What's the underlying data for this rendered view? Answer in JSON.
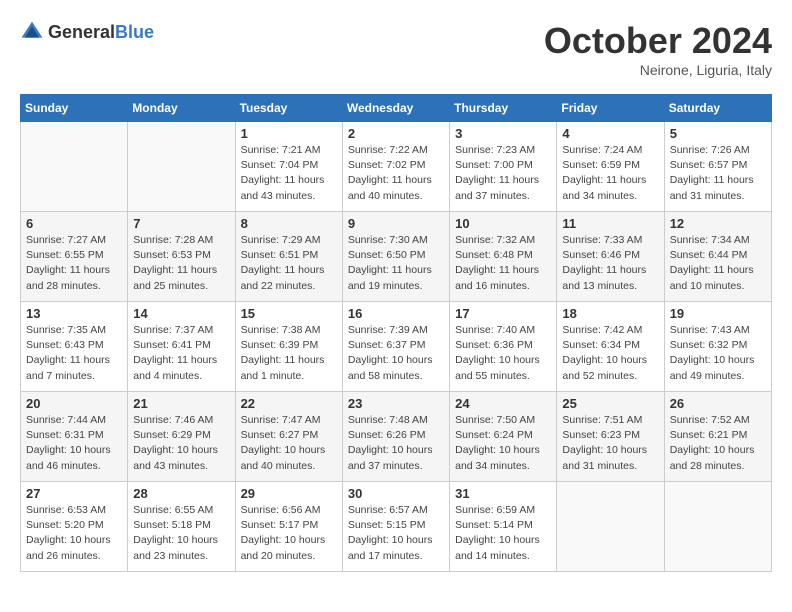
{
  "header": {
    "logo_general": "General",
    "logo_blue": "Blue",
    "month_title": "October 2024",
    "location": "Neirone, Liguria, Italy"
  },
  "days_of_week": [
    "Sunday",
    "Monday",
    "Tuesday",
    "Wednesday",
    "Thursday",
    "Friday",
    "Saturday"
  ],
  "weeks": [
    [
      {
        "day": "",
        "info": ""
      },
      {
        "day": "",
        "info": ""
      },
      {
        "day": "1",
        "info": "Sunrise: 7:21 AM\nSunset: 7:04 PM\nDaylight: 11 hours and 43 minutes."
      },
      {
        "day": "2",
        "info": "Sunrise: 7:22 AM\nSunset: 7:02 PM\nDaylight: 11 hours and 40 minutes."
      },
      {
        "day": "3",
        "info": "Sunrise: 7:23 AM\nSunset: 7:00 PM\nDaylight: 11 hours and 37 minutes."
      },
      {
        "day": "4",
        "info": "Sunrise: 7:24 AM\nSunset: 6:59 PM\nDaylight: 11 hours and 34 minutes."
      },
      {
        "day": "5",
        "info": "Sunrise: 7:26 AM\nSunset: 6:57 PM\nDaylight: 11 hours and 31 minutes."
      }
    ],
    [
      {
        "day": "6",
        "info": "Sunrise: 7:27 AM\nSunset: 6:55 PM\nDaylight: 11 hours and 28 minutes."
      },
      {
        "day": "7",
        "info": "Sunrise: 7:28 AM\nSunset: 6:53 PM\nDaylight: 11 hours and 25 minutes."
      },
      {
        "day": "8",
        "info": "Sunrise: 7:29 AM\nSunset: 6:51 PM\nDaylight: 11 hours and 22 minutes."
      },
      {
        "day": "9",
        "info": "Sunrise: 7:30 AM\nSunset: 6:50 PM\nDaylight: 11 hours and 19 minutes."
      },
      {
        "day": "10",
        "info": "Sunrise: 7:32 AM\nSunset: 6:48 PM\nDaylight: 11 hours and 16 minutes."
      },
      {
        "day": "11",
        "info": "Sunrise: 7:33 AM\nSunset: 6:46 PM\nDaylight: 11 hours and 13 minutes."
      },
      {
        "day": "12",
        "info": "Sunrise: 7:34 AM\nSunset: 6:44 PM\nDaylight: 11 hours and 10 minutes."
      }
    ],
    [
      {
        "day": "13",
        "info": "Sunrise: 7:35 AM\nSunset: 6:43 PM\nDaylight: 11 hours and 7 minutes."
      },
      {
        "day": "14",
        "info": "Sunrise: 7:37 AM\nSunset: 6:41 PM\nDaylight: 11 hours and 4 minutes."
      },
      {
        "day": "15",
        "info": "Sunrise: 7:38 AM\nSunset: 6:39 PM\nDaylight: 11 hours and 1 minute."
      },
      {
        "day": "16",
        "info": "Sunrise: 7:39 AM\nSunset: 6:37 PM\nDaylight: 10 hours and 58 minutes."
      },
      {
        "day": "17",
        "info": "Sunrise: 7:40 AM\nSunset: 6:36 PM\nDaylight: 10 hours and 55 minutes."
      },
      {
        "day": "18",
        "info": "Sunrise: 7:42 AM\nSunset: 6:34 PM\nDaylight: 10 hours and 52 minutes."
      },
      {
        "day": "19",
        "info": "Sunrise: 7:43 AM\nSunset: 6:32 PM\nDaylight: 10 hours and 49 minutes."
      }
    ],
    [
      {
        "day": "20",
        "info": "Sunrise: 7:44 AM\nSunset: 6:31 PM\nDaylight: 10 hours and 46 minutes."
      },
      {
        "day": "21",
        "info": "Sunrise: 7:46 AM\nSunset: 6:29 PM\nDaylight: 10 hours and 43 minutes."
      },
      {
        "day": "22",
        "info": "Sunrise: 7:47 AM\nSunset: 6:27 PM\nDaylight: 10 hours and 40 minutes."
      },
      {
        "day": "23",
        "info": "Sunrise: 7:48 AM\nSunset: 6:26 PM\nDaylight: 10 hours and 37 minutes."
      },
      {
        "day": "24",
        "info": "Sunrise: 7:50 AM\nSunset: 6:24 PM\nDaylight: 10 hours and 34 minutes."
      },
      {
        "day": "25",
        "info": "Sunrise: 7:51 AM\nSunset: 6:23 PM\nDaylight: 10 hours and 31 minutes."
      },
      {
        "day": "26",
        "info": "Sunrise: 7:52 AM\nSunset: 6:21 PM\nDaylight: 10 hours and 28 minutes."
      }
    ],
    [
      {
        "day": "27",
        "info": "Sunrise: 6:53 AM\nSunset: 5:20 PM\nDaylight: 10 hours and 26 minutes."
      },
      {
        "day": "28",
        "info": "Sunrise: 6:55 AM\nSunset: 5:18 PM\nDaylight: 10 hours and 23 minutes."
      },
      {
        "day": "29",
        "info": "Sunrise: 6:56 AM\nSunset: 5:17 PM\nDaylight: 10 hours and 20 minutes."
      },
      {
        "day": "30",
        "info": "Sunrise: 6:57 AM\nSunset: 5:15 PM\nDaylight: 10 hours and 17 minutes."
      },
      {
        "day": "31",
        "info": "Sunrise: 6:59 AM\nSunset: 5:14 PM\nDaylight: 10 hours and 14 minutes."
      },
      {
        "day": "",
        "info": ""
      },
      {
        "day": "",
        "info": ""
      }
    ]
  ]
}
